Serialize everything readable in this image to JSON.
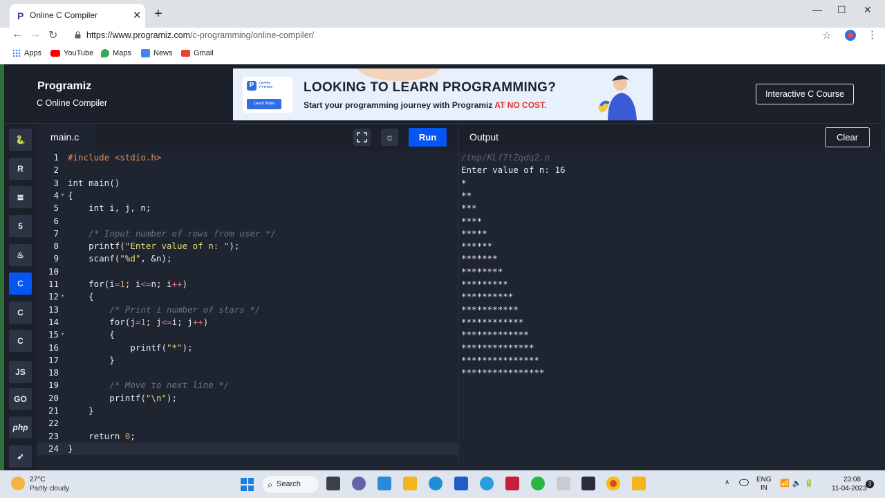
{
  "browser": {
    "tab_title": "Online C Compiler",
    "url_host": "https://www.programiz.com",
    "url_path": "/c-programming/online-compiler/",
    "bookmarks": [
      {
        "label": "Apps",
        "icon": "apps-grid-icon"
      },
      {
        "label": "YouTube",
        "icon": "youtube-icon",
        "color": "#ff0000"
      },
      {
        "label": "Maps",
        "icon": "maps-icon",
        "color": "#34a853"
      },
      {
        "label": "News",
        "icon": "news-icon",
        "color": "#4285f4"
      },
      {
        "label": "Gmail",
        "icon": "gmail-icon",
        "color": "#ea4335"
      }
    ]
  },
  "header": {
    "logo": "Programiz",
    "subtitle": "C Online Compiler",
    "course_button": "Interactive C Course",
    "ad": {
      "card_tag": "LEARN PYTHON",
      "card_button": "Learn More",
      "headline": "LOOKING TO LEARN PROGRAMMING?",
      "sub_prefix": "Start your programming journey with Programiz ",
      "sub_highlight": "AT NO COST."
    }
  },
  "rail": {
    "languages": [
      {
        "name": "python",
        "glyph": "🐍"
      },
      {
        "name": "r",
        "glyph": "R"
      },
      {
        "name": "sql",
        "glyph": "≣"
      },
      {
        "name": "html",
        "glyph": "5"
      },
      {
        "name": "java",
        "glyph": "♨"
      },
      {
        "name": "c",
        "glyph": "C",
        "active": true
      },
      {
        "name": "cpp",
        "glyph": "C"
      },
      {
        "name": "csharp",
        "glyph": "C"
      },
      {
        "name": "javascript",
        "glyph": "JS"
      },
      {
        "name": "go",
        "glyph": "GO"
      },
      {
        "name": "php",
        "glyph": "php"
      },
      {
        "name": "swift",
        "glyph": "➶"
      }
    ]
  },
  "editor": {
    "file_name": "main.c",
    "run_label": "Run",
    "line_numbers": [
      "1",
      "2",
      "3",
      "4",
      "5",
      "6",
      "7",
      "8",
      "9",
      "10",
      "11",
      "12",
      "13",
      "14",
      "15",
      "16",
      "17",
      "18",
      "19",
      "20",
      "21",
      "22",
      "23",
      "24"
    ],
    "folded_lines": [
      "4",
      "12",
      "15"
    ]
  },
  "output": {
    "label": "Output",
    "clear_label": "Clear",
    "tmp_path": "/tmp/KLf7tZqdq2.o",
    "lines": [
      "Enter value of n: 16",
      "*",
      "**",
      "***",
      "****",
      "*****",
      "******",
      "*******",
      "********",
      "*********",
      "**********",
      "***********",
      "************",
      "*************",
      "**************",
      "***************",
      "****************"
    ]
  },
  "taskbar": {
    "temp": "27°C",
    "weather": "Partly cloudy",
    "search_label": "Search",
    "lang_line1": "ENG",
    "lang_line2": "IN",
    "time": "23:08",
    "date": "11-04-2023",
    "notifications": "3"
  }
}
